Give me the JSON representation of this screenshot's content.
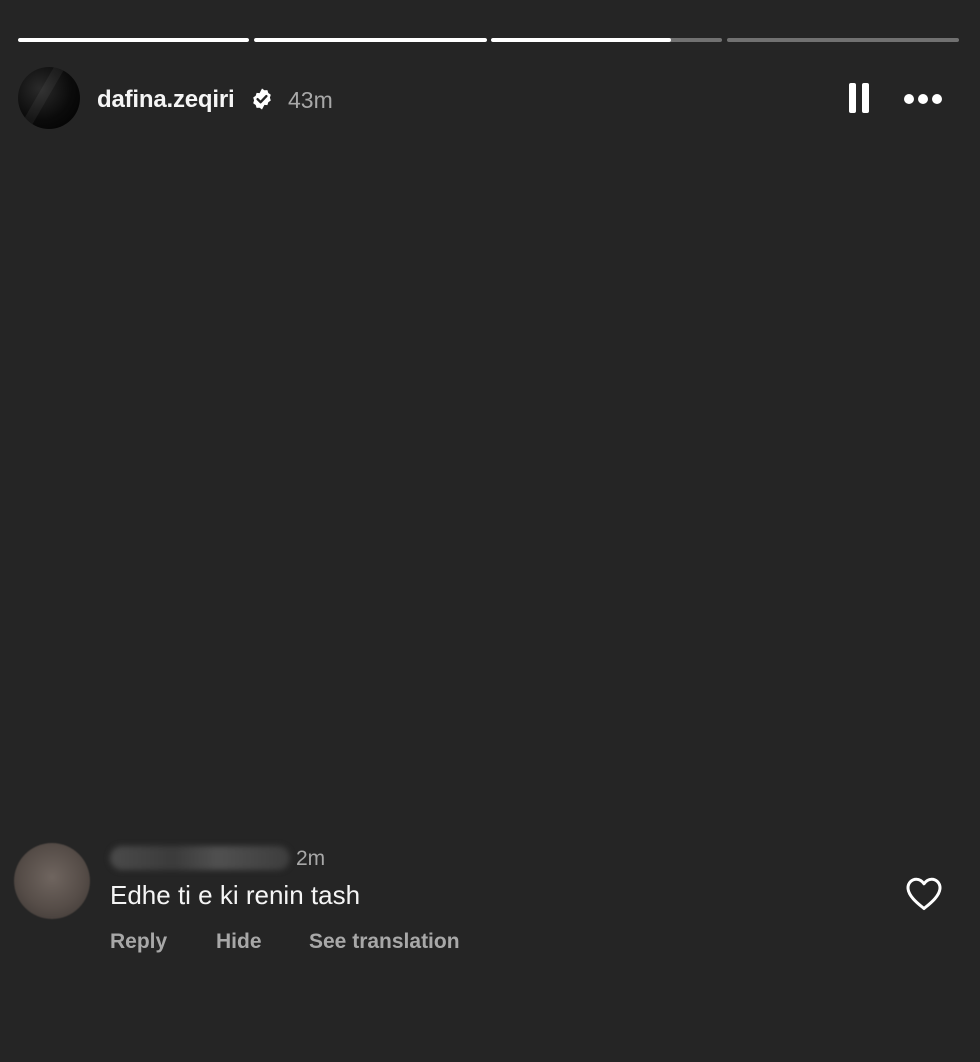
{
  "story": {
    "username": "dafina.zeqiri",
    "time": "43m",
    "verified": true,
    "progress": [
      1.0,
      1.0,
      0.78,
      0.0
    ]
  },
  "icons": {
    "verified": "verified-badge-icon",
    "pause": "pause-icon",
    "more": "more-options-icon",
    "heart": "heart-icon"
  },
  "comment": {
    "time": "2m",
    "text": "Edhe ti e ki renin tash",
    "actions": {
      "reply": "Reply",
      "hide": "Hide",
      "translate": "See translation"
    }
  },
  "colors": {
    "background": "#252525",
    "secondary_text": "#a8a8a8",
    "primary_text": "#f5f5f5"
  }
}
